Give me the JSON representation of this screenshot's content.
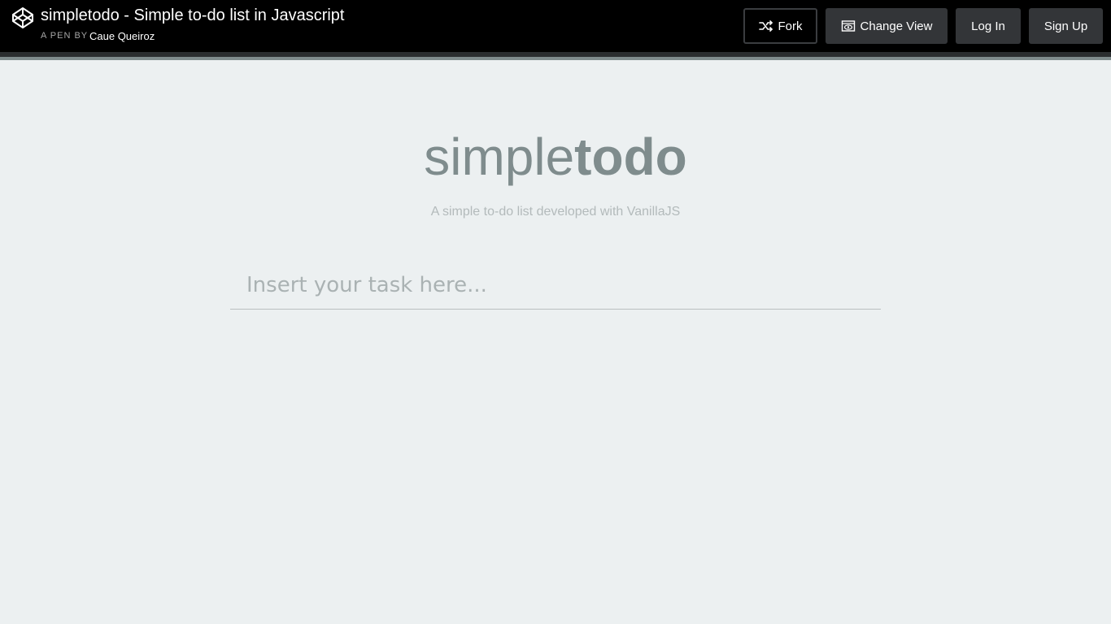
{
  "header": {
    "title": "simpletodo - Simple to-do list in Javascript",
    "byline_prefix": "A PEN BY",
    "author": "Caue Queiroz",
    "buttons": {
      "fork": "Fork",
      "change_view": "Change View",
      "log_in": "Log In",
      "sign_up": "Sign Up"
    },
    "icons": {
      "logo": "codepen-logo-icon",
      "fork": "fork-icon",
      "change_view": "eye-window-icon"
    }
  },
  "app": {
    "title_light": "simple",
    "title_bold": "todo",
    "subtitle": "A simple to-do list developed with VanillaJS",
    "input": {
      "value": "",
      "placeholder": "Insert your task here..."
    },
    "tasks": []
  },
  "colors": {
    "header_bg": "#000000",
    "page_bg": "#ecf0f1",
    "title": "#7f8c8d",
    "subtitle": "#b3babb",
    "button_bg": "#333538"
  }
}
